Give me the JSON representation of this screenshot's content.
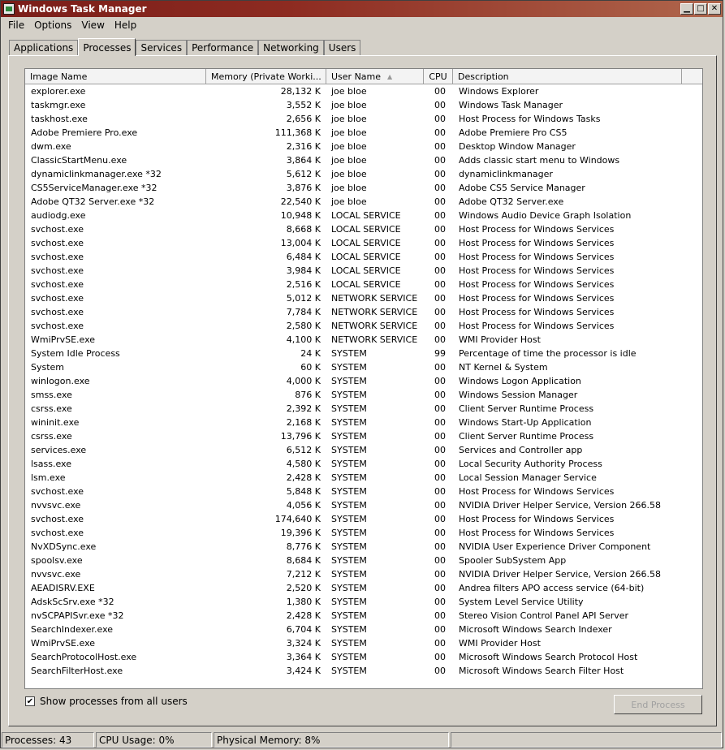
{
  "window": {
    "title": "Windows Task Manager"
  },
  "menu": [
    "File",
    "Options",
    "View",
    "Help"
  ],
  "tabs": [
    "Applications",
    "Processes",
    "Services",
    "Performance",
    "Networking",
    "Users"
  ],
  "active_tab": "Processes",
  "columns": [
    "Image Name",
    "Memory (Private Worki...",
    "User Name",
    "CPU",
    "Description"
  ],
  "processes": [
    {
      "name": "explorer.exe",
      "mem": "28,132 K",
      "user": "joe bloe",
      "cpu": "00",
      "desc": "Windows Explorer"
    },
    {
      "name": "taskmgr.exe",
      "mem": "3,552 K",
      "user": "joe bloe",
      "cpu": "00",
      "desc": "Windows Task Manager"
    },
    {
      "name": "taskhost.exe",
      "mem": "2,656 K",
      "user": "joe bloe",
      "cpu": "00",
      "desc": "Host Process for Windows Tasks"
    },
    {
      "name": "Adobe Premiere Pro.exe",
      "mem": "111,368 K",
      "user": "joe bloe",
      "cpu": "00",
      "desc": "Adobe Premiere Pro CS5"
    },
    {
      "name": "dwm.exe",
      "mem": "2,316 K",
      "user": "joe bloe",
      "cpu": "00",
      "desc": "Desktop Window Manager"
    },
    {
      "name": "ClassicStartMenu.exe",
      "mem": "3,864 K",
      "user": "joe bloe",
      "cpu": "00",
      "desc": "Adds classic start menu to Windows"
    },
    {
      "name": "dynamiclinkmanager.exe *32",
      "mem": "5,612 K",
      "user": "joe bloe",
      "cpu": "00",
      "desc": "dynamiclinkmanager"
    },
    {
      "name": "CS5ServiceManager.exe *32",
      "mem": "3,876 K",
      "user": "joe bloe",
      "cpu": "00",
      "desc": "Adobe CS5 Service Manager"
    },
    {
      "name": "Adobe QT32 Server.exe *32",
      "mem": "22,540 K",
      "user": "joe bloe",
      "cpu": "00",
      "desc": "Adobe QT32 Server.exe"
    },
    {
      "name": "audiodg.exe",
      "mem": "10,948 K",
      "user": "LOCAL SERVICE",
      "cpu": "00",
      "desc": "Windows Audio Device Graph Isolation"
    },
    {
      "name": "svchost.exe",
      "mem": "8,668 K",
      "user": "LOCAL SERVICE",
      "cpu": "00",
      "desc": "Host Process for Windows Services"
    },
    {
      "name": "svchost.exe",
      "mem": "13,004 K",
      "user": "LOCAL SERVICE",
      "cpu": "00",
      "desc": "Host Process for Windows Services"
    },
    {
      "name": "svchost.exe",
      "mem": "6,484 K",
      "user": "LOCAL SERVICE",
      "cpu": "00",
      "desc": "Host Process for Windows Services"
    },
    {
      "name": "svchost.exe",
      "mem": "3,984 K",
      "user": "LOCAL SERVICE",
      "cpu": "00",
      "desc": "Host Process for Windows Services"
    },
    {
      "name": "svchost.exe",
      "mem": "2,516 K",
      "user": "LOCAL SERVICE",
      "cpu": "00",
      "desc": "Host Process for Windows Services"
    },
    {
      "name": "svchost.exe",
      "mem": "5,012 K",
      "user": "NETWORK SERVICE",
      "cpu": "00",
      "desc": "Host Process for Windows Services"
    },
    {
      "name": "svchost.exe",
      "mem": "7,784 K",
      "user": "NETWORK SERVICE",
      "cpu": "00",
      "desc": "Host Process for Windows Services"
    },
    {
      "name": "svchost.exe",
      "mem": "2,580 K",
      "user": "NETWORK SERVICE",
      "cpu": "00",
      "desc": "Host Process for Windows Services"
    },
    {
      "name": "WmiPrvSE.exe",
      "mem": "4,100 K",
      "user": "NETWORK SERVICE",
      "cpu": "00",
      "desc": "WMI Provider Host"
    },
    {
      "name": "System Idle Process",
      "mem": "24 K",
      "user": "SYSTEM",
      "cpu": "99",
      "desc": "Percentage of time the processor is idle"
    },
    {
      "name": "System",
      "mem": "60 K",
      "user": "SYSTEM",
      "cpu": "00",
      "desc": "NT Kernel & System"
    },
    {
      "name": "winlogon.exe",
      "mem": "4,000 K",
      "user": "SYSTEM",
      "cpu": "00",
      "desc": "Windows Logon Application"
    },
    {
      "name": "smss.exe",
      "mem": "876 K",
      "user": "SYSTEM",
      "cpu": "00",
      "desc": "Windows Session Manager"
    },
    {
      "name": "csrss.exe",
      "mem": "2,392 K",
      "user": "SYSTEM",
      "cpu": "00",
      "desc": "Client Server Runtime Process"
    },
    {
      "name": "wininit.exe",
      "mem": "2,168 K",
      "user": "SYSTEM",
      "cpu": "00",
      "desc": "Windows Start-Up Application"
    },
    {
      "name": "csrss.exe",
      "mem": "13,796 K",
      "user": "SYSTEM",
      "cpu": "00",
      "desc": "Client Server Runtime Process"
    },
    {
      "name": "services.exe",
      "mem": "6,512 K",
      "user": "SYSTEM",
      "cpu": "00",
      "desc": "Services and Controller app"
    },
    {
      "name": "lsass.exe",
      "mem": "4,580 K",
      "user": "SYSTEM",
      "cpu": "00",
      "desc": "Local Security Authority Process"
    },
    {
      "name": "lsm.exe",
      "mem": "2,428 K",
      "user": "SYSTEM",
      "cpu": "00",
      "desc": "Local Session Manager Service"
    },
    {
      "name": "svchost.exe",
      "mem": "5,848 K",
      "user": "SYSTEM",
      "cpu": "00",
      "desc": "Host Process for Windows Services"
    },
    {
      "name": "nvvsvc.exe",
      "mem": "4,056 K",
      "user": "SYSTEM",
      "cpu": "00",
      "desc": "NVIDIA Driver Helper Service, Version 266.58"
    },
    {
      "name": "svchost.exe",
      "mem": "174,640 K",
      "user": "SYSTEM",
      "cpu": "00",
      "desc": "Host Process for Windows Services"
    },
    {
      "name": "svchost.exe",
      "mem": "19,396 K",
      "user": "SYSTEM",
      "cpu": "00",
      "desc": "Host Process for Windows Services"
    },
    {
      "name": "NvXDSync.exe",
      "mem": "8,776 K",
      "user": "SYSTEM",
      "cpu": "00",
      "desc": "NVIDIA User Experience Driver Component"
    },
    {
      "name": "spoolsv.exe",
      "mem": "8,684 K",
      "user": "SYSTEM",
      "cpu": "00",
      "desc": "Spooler SubSystem App"
    },
    {
      "name": "nvvsvc.exe",
      "mem": "7,212 K",
      "user": "SYSTEM",
      "cpu": "00",
      "desc": "NVIDIA Driver Helper Service, Version 266.58"
    },
    {
      "name": "AEADISRV.EXE",
      "mem": "2,520 K",
      "user": "SYSTEM",
      "cpu": "00",
      "desc": "Andrea filters APO access service (64-bit)"
    },
    {
      "name": "AdskScSrv.exe *32",
      "mem": "1,380 K",
      "user": "SYSTEM",
      "cpu": "00",
      "desc": "System Level Service Utility"
    },
    {
      "name": "nvSCPAPISvr.exe *32",
      "mem": "2,428 K",
      "user": "SYSTEM",
      "cpu": "00",
      "desc": "Stereo Vision Control Panel API Server"
    },
    {
      "name": "SearchIndexer.exe",
      "mem": "6,704 K",
      "user": "SYSTEM",
      "cpu": "00",
      "desc": "Microsoft Windows Search Indexer"
    },
    {
      "name": "WmiPrvSE.exe",
      "mem": "3,324 K",
      "user": "SYSTEM",
      "cpu": "00",
      "desc": "WMI Provider Host"
    },
    {
      "name": "SearchProtocolHost.exe",
      "mem": "3,364 K",
      "user": "SYSTEM",
      "cpu": "00",
      "desc": "Microsoft Windows Search Protocol Host"
    },
    {
      "name": "SearchFilterHost.exe",
      "mem": "3,424 K",
      "user": "SYSTEM",
      "cpu": "00",
      "desc": "Microsoft Windows Search Filter Host"
    }
  ],
  "show_all_label": "Show processes from all users",
  "show_all_checked": true,
  "end_process_label": "End Process",
  "status": {
    "processes": "Processes: 43",
    "cpu": "CPU Usage: 0%",
    "memory": "Physical Memory: 8%"
  },
  "colors": {
    "titlebar": "#7a1d18",
    "face": "#d4d0c8"
  },
  "icons": {
    "app": "task-manager-icon",
    "minimize": "minimize-icon",
    "maximize": "maximize-icon",
    "close": "close-icon",
    "sort": "sort-ascending-icon",
    "check": "checkmark-icon"
  }
}
